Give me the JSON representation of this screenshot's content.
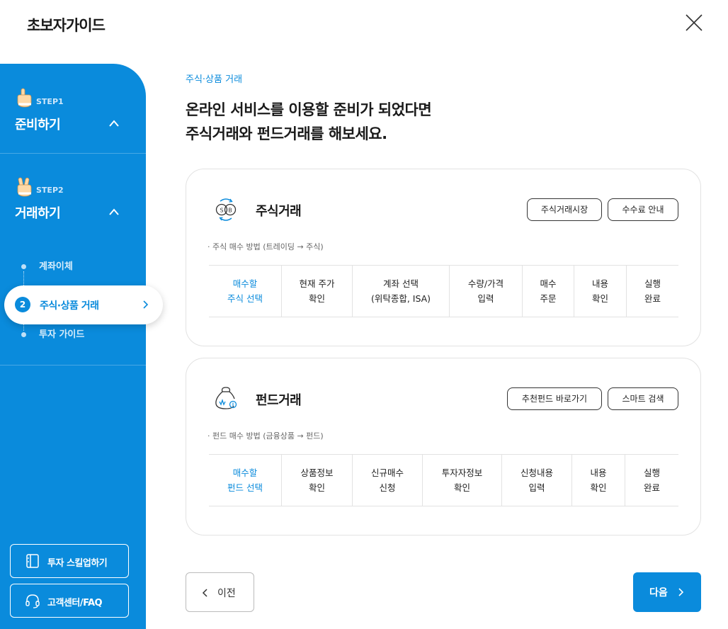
{
  "header": {
    "title": "초보자가이드",
    "close_icon": "close-icon"
  },
  "sidebar": {
    "bg_color": "#0a8bdc",
    "step1": {
      "label": "STEP1",
      "title": "준비하기",
      "icon": "pointing-hand-icon",
      "expanded": true
    },
    "step2": {
      "label": "STEP2",
      "title": "거래하기",
      "icon": "victory-hand-icon",
      "expanded": true,
      "items": [
        {
          "label": "계좌이체"
        },
        {
          "number": "2",
          "label": "주식·상품 거래",
          "active": true
        },
        {
          "label": "투자 가이드"
        }
      ]
    },
    "buttons": [
      {
        "label": "투자 스킬업하기",
        "icon": "book-icon"
      },
      {
        "label": "고객센터/FAQ",
        "icon": "headset-icon"
      }
    ]
  },
  "main": {
    "breadcrumb": "주식·상품 거래",
    "headline_line1": "온라인 서비스를 이용할 준비가 되었다면",
    "headline_line2": "주식거래와 펀드거래를 해보세요.",
    "stock": {
      "title": "주식거래",
      "icon": "stock-exchange-icon",
      "buttons": [
        "주식거래시장",
        "수수료 안내"
      ],
      "note": "· 주식 매수 방법 (트레이딩 → 주식)",
      "steps": [
        "매수할\n주식 선택",
        "현재 주가\n확인",
        "계좌 선택\n(위탁종합, ISA)",
        "수량/가격\n입력",
        "매수\n주문",
        "내용\n확인",
        "실행\n완료"
      ]
    },
    "fund": {
      "title": "펀드거래",
      "icon": "money-bag-icon",
      "buttons": [
        "추천펀드 바로가기",
        "스마트 검색"
      ],
      "note": "· 펀드 매수 방법 (금융상품 → 펀드)",
      "steps": [
        "매수할\n펀드 선택",
        "상품정보\n확인",
        "신규매수\n신청",
        "투자자정보\n확인",
        "신청내용\n입력",
        "내용\n확인",
        "실행\n완료"
      ]
    }
  },
  "footer": {
    "prev_label": "이전",
    "next_label": "다음"
  }
}
